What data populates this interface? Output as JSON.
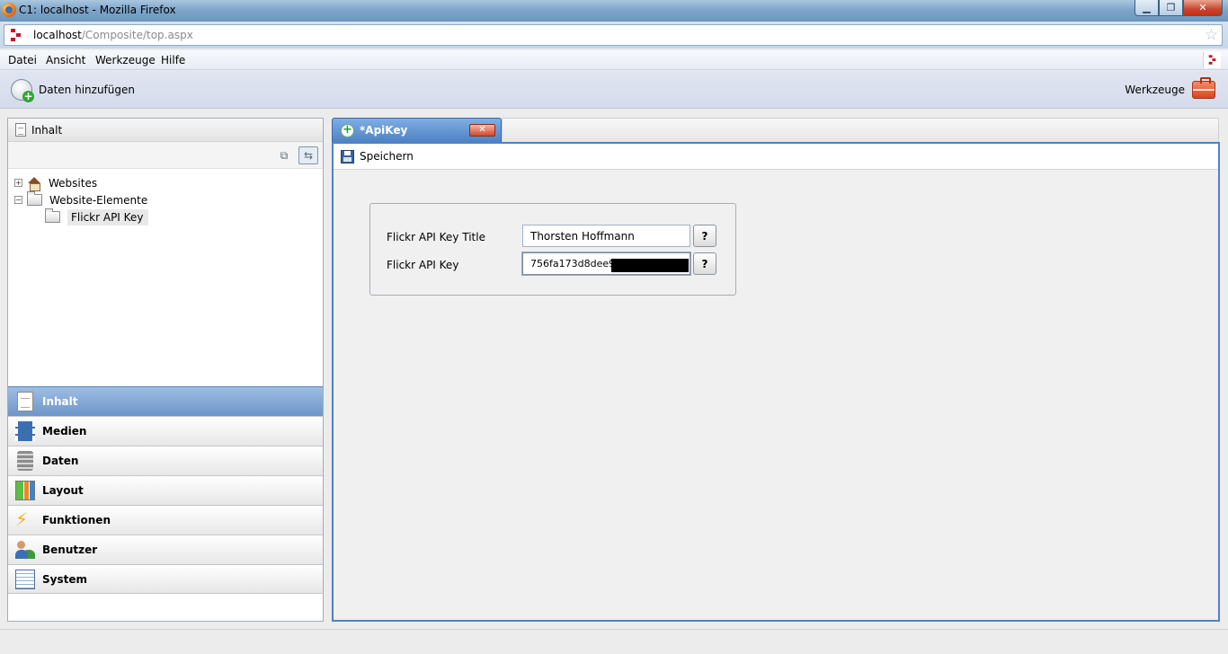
{
  "window": {
    "title": "C1: localhost - Mozilla Firefox",
    "minimize_label": "▁",
    "maximize_label": "❐",
    "close_label": "✕"
  },
  "address": {
    "host": "localhost",
    "path": "/Composite/top.aspx"
  },
  "menu": {
    "items": [
      "Datei",
      "Ansicht",
      "Werkzeuge",
      "Hilfe"
    ]
  },
  "toolbar": {
    "add_data_label": "Daten hinzufügen",
    "tools_label": "Werkzeuge"
  },
  "left_panel": {
    "header": "Inhalt",
    "tree": {
      "websites": "Websites",
      "website_elements": "Website-Elemente",
      "flickr_api_key": "Flickr API Key"
    },
    "nav": [
      "Inhalt",
      "Medien",
      "Daten",
      "Layout",
      "Funktionen",
      "Benutzer",
      "System"
    ]
  },
  "editor": {
    "tab_title": "*ApiKey",
    "save_label": "Speichern",
    "fields": {
      "title_label": "Flickr API Key Title",
      "title_value": "Thorsten Hoffmann",
      "key_label": "Flickr API Key",
      "key_value": "756fa173d8dee97",
      "help_label": "?"
    }
  },
  "icons": [
    "firefox-icon",
    "c1-icon",
    "star-icon",
    "add-data-icon",
    "toolbox-icon",
    "document-icon",
    "collapse-icon",
    "sync-icon",
    "house-icon",
    "folder-icon",
    "media-icon",
    "database-icon",
    "layout-icon",
    "lightning-icon",
    "users-icon",
    "system-icon",
    "add-icon",
    "close-icon",
    "save-icon"
  ],
  "colors": {
    "accent": "#4f82c3",
    "active_nav": "#6e96c8",
    "close_red": "#c8462a",
    "add_green": "#2fa632"
  }
}
